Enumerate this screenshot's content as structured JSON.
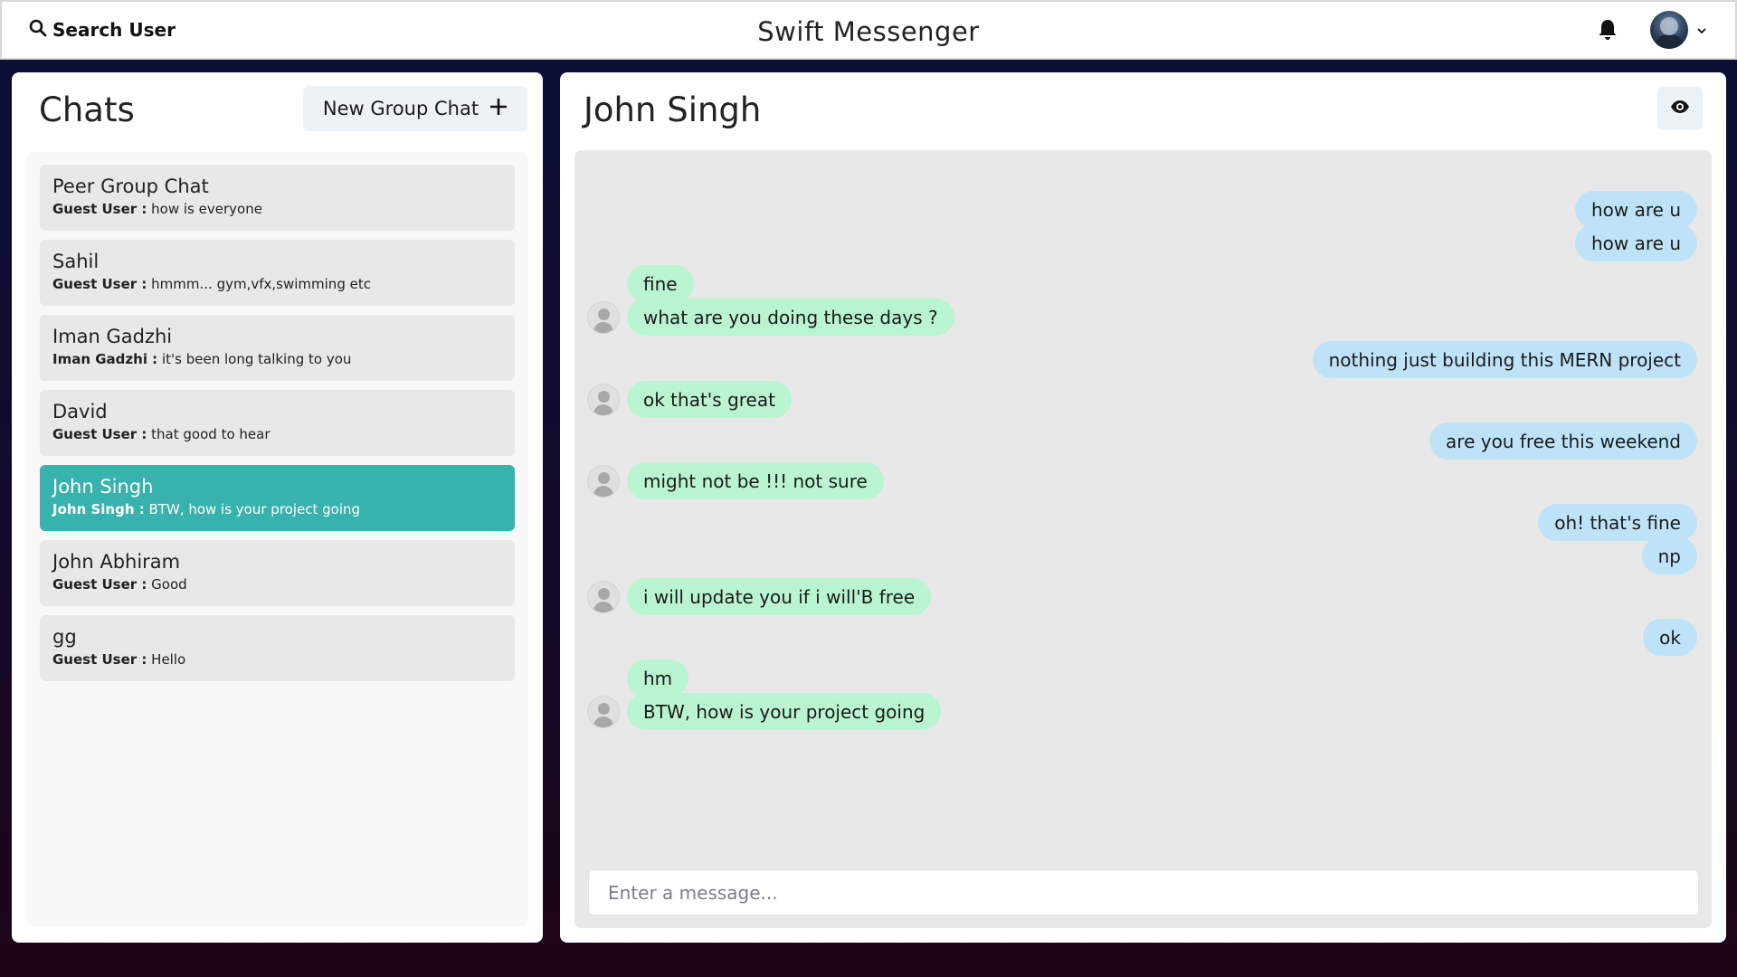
{
  "header": {
    "search_label": "Search User",
    "app_title": "Swift Messenger"
  },
  "sidebar": {
    "title": "Chats",
    "new_group_label": "New Group Chat",
    "chats": [
      {
        "name": "Peer Group Chat",
        "sender": "Guest User :",
        "preview": "how is everyone",
        "active": false
      },
      {
        "name": "Sahil",
        "sender": "Guest User :",
        "preview": "hmmm... gym,vfx,swimming etc",
        "active": false
      },
      {
        "name": "Iman Gadzhi",
        "sender": "Iman Gadzhi :",
        "preview": "it's been long talking to you",
        "active": false
      },
      {
        "name": "David",
        "sender": "Guest User :",
        "preview": "that good to hear",
        "active": false
      },
      {
        "name": "John Singh",
        "sender": "John Singh :",
        "preview": "BTW, how is your project going",
        "active": true
      },
      {
        "name": "John Abhiram",
        "sender": "Guest User :",
        "preview": "Good",
        "active": false
      },
      {
        "name": "gg",
        "sender": "Guest User :",
        "preview": "Hello",
        "active": false
      }
    ]
  },
  "conversation": {
    "title": "John Singh",
    "messages": [
      {
        "side": "right",
        "text": "how are u",
        "avatar": false
      },
      {
        "side": "right",
        "text": "how are u",
        "avatar": false
      },
      {
        "side": "left",
        "text": "fine",
        "avatar": false
      },
      {
        "side": "left",
        "text": "what are you doing these days ?",
        "avatar": true
      },
      {
        "side": "right",
        "text": "nothing just building this MERN project",
        "avatar": false
      },
      {
        "side": "left",
        "text": "ok that's great",
        "avatar": true
      },
      {
        "side": "right",
        "text": "are you free this weekend",
        "avatar": false
      },
      {
        "side": "left",
        "text": "might not be !!! not sure",
        "avatar": true
      },
      {
        "side": "right",
        "text": "oh! that's fine",
        "avatar": false
      },
      {
        "side": "right",
        "text": "np",
        "avatar": false
      },
      {
        "side": "left",
        "text": "i will update you if i will'B free",
        "avatar": true
      },
      {
        "side": "right",
        "text": "ok",
        "avatar": false
      },
      {
        "side": "left",
        "text": "hm",
        "avatar": false
      },
      {
        "side": "left",
        "text": "BTW, how is your project going",
        "avatar": true
      }
    ],
    "input_placeholder": "Enter a message..."
  },
  "colors": {
    "active_chat": "#38b2ac",
    "sent_bubble": "#bee3f8",
    "received_bubble": "#b9f5d0"
  }
}
